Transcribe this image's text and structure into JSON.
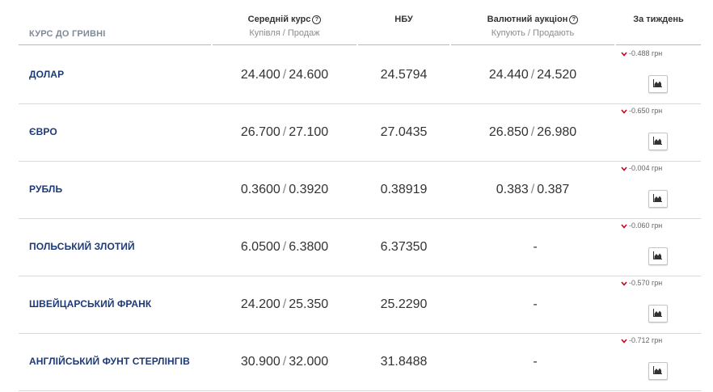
{
  "header": {
    "currency_col": "КУРС ДО ГРИВНІ",
    "avg_title": "Середній курс",
    "avg_sub": "Купівля / Продаж",
    "nbu_title": "НБУ",
    "auction_title": "Валютний аукціон",
    "auction_sub": "Купують / Продають",
    "week_title": "За тиждень"
  },
  "colors": {
    "currency_name": "#1d3a78",
    "down_arrow": "#d0021b",
    "divider": "#d9d9d9"
  },
  "icons": {
    "help": "question-circle-icon",
    "down": "chevron-down-icon",
    "chart": "area-chart-icon"
  },
  "rows": [
    {
      "name": "ДОЛАР",
      "avg_buy": "24.400",
      "avg_sell": "24.600",
      "nbu": "24.5794",
      "auc_buy": "24.440",
      "auc_sell": "24.520",
      "auc_dash": "",
      "sep_avg": "/",
      "sep_auc": "/",
      "change": "-0.488 грн"
    },
    {
      "name": "ЄВРО",
      "avg_buy": "26.700",
      "avg_sell": "27.100",
      "nbu": "27.0435",
      "auc_buy": "26.850",
      "auc_sell": "26.980",
      "auc_dash": "",
      "sep_avg": "/",
      "sep_auc": "/",
      "change": "-0.650 грн"
    },
    {
      "name": "РУБЛЬ",
      "avg_buy": "0.3600",
      "avg_sell": "0.3920",
      "nbu": "0.38919",
      "auc_buy": "0.383",
      "auc_sell": "0.387",
      "auc_dash": "",
      "sep_avg": "/",
      "sep_auc": "/",
      "change": "-0.004 грн"
    },
    {
      "name": "ПОЛЬСЬКИЙ ЗЛОТИЙ",
      "avg_buy": "6.0500",
      "avg_sell": "6.3800",
      "nbu": "6.37350",
      "auc_buy": "",
      "auc_sell": "",
      "auc_dash": "-",
      "sep_avg": "/",
      "sep_auc": "",
      "change": "-0.060 грн"
    },
    {
      "name": "ШВЕЙЦАРСЬКИЙ ФРАНК",
      "avg_buy": "24.200",
      "avg_sell": "25.350",
      "nbu": "25.2290",
      "auc_buy": "",
      "auc_sell": "",
      "auc_dash": "-",
      "sep_avg": "/",
      "sep_auc": "",
      "change": "-0.570 грн"
    },
    {
      "name": "АНГЛІЙСЬКИЙ ФУНТ СТЕРЛІНГІВ",
      "avg_buy": "30.900",
      "avg_sell": "32.000",
      "nbu": "31.8488",
      "auc_buy": "",
      "auc_sell": "",
      "auc_dash": "-",
      "sep_avg": "/",
      "sep_auc": "",
      "change": "-0.712 грн"
    }
  ]
}
